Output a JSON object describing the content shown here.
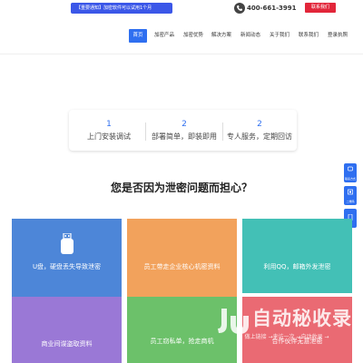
{
  "topbar": {
    "notice": "【重要通知】加密软件可以试用1个月",
    "phone": "400-661-3991",
    "contact_button": "联系我们"
  },
  "nav": {
    "items": [
      "首页",
      "加密产品",
      "加密优势",
      "解决方案",
      "新闻动态",
      "关于我们",
      "联系我们",
      "登录执照"
    ]
  },
  "features": [
    {
      "num": "1",
      "text": "上门安装调试"
    },
    {
      "num": "2",
      "text": "部署简单，即装即用"
    },
    {
      "num": "2",
      "text": "专人服务，定期回访"
    }
  ],
  "question": "您是否因为泄密问题而担心？",
  "side_buttons": [
    {
      "label": "联系方式",
      "icon": "chat-icon"
    },
    {
      "label": "二维码",
      "icon": "qrcode-icon"
    },
    {
      "label": "",
      "icon": "phone-icon"
    }
  ],
  "cards": [
    {
      "text": "U盘，硬盘丢失导致泄密",
      "icon": "usb-icon"
    },
    {
      "text": "员工带走企业核心机密资料"
    },
    {
      "text": "利用QQ，邮箱外发泄密"
    },
    {
      "text": "商业间谍盗取资料"
    },
    {
      "text": "员工窃私单，抢走商机"
    },
    {
      "text": "合作伙伴无意泄密"
    }
  ],
  "watermark": {
    "title": "自动秘收录",
    "subtitle": "做上链接 →来访一次 →自动收录 →"
  },
  "colors": {
    "accent": "#2f6ff0",
    "contact": "#e2263a",
    "card_blue": "#4d86d8",
    "card_orange": "#f2a25c",
    "card_teal": "#43c0b6",
    "card_purple": "#9a78d6",
    "card_green": "#6cc16a",
    "card_red": "#ea6a73"
  }
}
